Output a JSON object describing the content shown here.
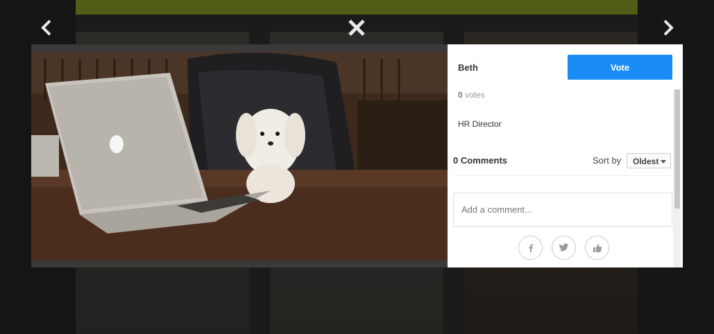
{
  "navigation": {
    "prev_icon": "chevron-left-icon",
    "next_icon": "chevron-right-icon",
    "close_icon": "close-icon"
  },
  "photo": {
    "description_icon": "photo-dog-at-laptop"
  },
  "entry": {
    "author": "Beth",
    "vote_label": "Vote",
    "vote_count": "0",
    "vote_suffix": " votes",
    "caption": "HR Director"
  },
  "comments": {
    "count_label": "0 Comments",
    "sort_label": "Sort by",
    "sort_value": "Oldest",
    "placeholder": "Add a comment..."
  },
  "share": {
    "facebook_icon": "facebook-icon",
    "twitter_icon": "twitter-icon",
    "like_icon": "thumbs-up-icon"
  },
  "colors": {
    "vote_button": "#1a8cf5",
    "banner": "#4f5d16",
    "overlay": "#1b1b1b"
  }
}
